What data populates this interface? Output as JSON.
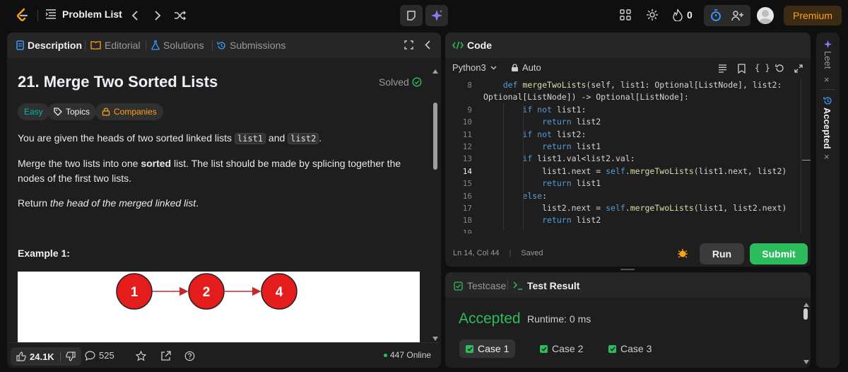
{
  "topbar": {
    "problem_list_label": "Problem List",
    "fire_count": "0",
    "premium_label": "Premium"
  },
  "description_panel": {
    "tabs": [
      {
        "label": "Description",
        "icon": "document-icon",
        "active": true
      },
      {
        "label": "Editorial",
        "icon": "book-icon",
        "active": false
      },
      {
        "label": "Solutions",
        "icon": "flask-icon",
        "active": false
      },
      {
        "label": "Submissions",
        "icon": "history-icon",
        "active": false
      }
    ],
    "title": "21. Merge Two Sorted Lists",
    "solved_label": "Solved",
    "tags": {
      "difficulty": "Easy",
      "topics": "Topics",
      "companies": "Companies"
    },
    "para1": {
      "before": "You are given the heads of two sorted linked lists ",
      "code1": "list1",
      "mid": " and ",
      "code2": "list2",
      "after": "."
    },
    "para2": {
      "before": "Merge the two lists into one ",
      "bold": "sorted",
      "after": " list. The list should be made by splicing together the nodes of the first two lists."
    },
    "para3": {
      "before": "Return ",
      "italic": "the head of the merged linked list",
      "after": "."
    },
    "example_label": "Example 1:",
    "figure_nodes": [
      "1",
      "2",
      "4"
    ],
    "footer": {
      "likes": "24.1K",
      "comments": "525",
      "online": "447 Online"
    }
  },
  "code_panel": {
    "title": "Code",
    "language": "Python3",
    "mode": "Auto",
    "lines": [
      {
        "n": "8",
        "tokens": [
          [
            "tx",
            "    "
          ],
          [
            "kw",
            "def "
          ],
          [
            "fn",
            "mergeTwoLists"
          ],
          [
            "tx",
            "(self, list1: Optional[ListNode], list2:"
          ]
        ]
      },
      {
        "n": "",
        "tokens": [
          [
            "tx",
            "Optional[ListNode]) -> Optional[ListNode]:"
          ]
        ]
      },
      {
        "n": "9",
        "tokens": [
          [
            "tx",
            "        "
          ],
          [
            "kw",
            "if not "
          ],
          [
            "tx",
            "list1:"
          ]
        ]
      },
      {
        "n": "10",
        "tokens": [
          [
            "tx",
            "            "
          ],
          [
            "kw",
            "return "
          ],
          [
            "tx",
            "list2"
          ]
        ]
      },
      {
        "n": "11",
        "tokens": [
          [
            "tx",
            "        "
          ],
          [
            "kw",
            "if not "
          ],
          [
            "tx",
            "list2:"
          ]
        ]
      },
      {
        "n": "12",
        "tokens": [
          [
            "tx",
            "            "
          ],
          [
            "kw",
            "return "
          ],
          [
            "tx",
            "list1"
          ]
        ]
      },
      {
        "n": "13",
        "tokens": [
          [
            "tx",
            "        "
          ],
          [
            "kw",
            "if "
          ],
          [
            "tx",
            "list1.val<list2.val:"
          ]
        ]
      },
      {
        "n": "14",
        "tokens": [
          [
            "tx",
            "            list1.next = "
          ],
          [
            "kw",
            "self"
          ],
          [
            "tx",
            "."
          ],
          [
            "fn",
            "mergeTwoLists"
          ],
          [
            "tx",
            "(list1.next, list2)"
          ]
        ]
      },
      {
        "n": "15",
        "tokens": [
          [
            "tx",
            "            "
          ],
          [
            "kw",
            "return "
          ],
          [
            "tx",
            "list1"
          ]
        ]
      },
      {
        "n": "16",
        "tokens": [
          [
            "tx",
            "        "
          ],
          [
            "kw",
            "else"
          ],
          [
            "tx",
            ":"
          ]
        ]
      },
      {
        "n": "17",
        "tokens": [
          [
            "tx",
            "            list2.next = "
          ],
          [
            "kw",
            "self"
          ],
          [
            "tx",
            "."
          ],
          [
            "fn",
            "mergeTwoLists"
          ],
          [
            "tx",
            "(list1, list2.next)"
          ]
        ]
      },
      {
        "n": "18",
        "tokens": [
          [
            "tx",
            "            "
          ],
          [
            "kw",
            "return "
          ],
          [
            "tx",
            "list2"
          ]
        ]
      },
      {
        "n": "19",
        "tokens": [
          [
            "tx",
            ""
          ]
        ]
      }
    ],
    "cursor": "Ln 14, Col 44",
    "saved": "Saved",
    "run_label": "Run",
    "submit_label": "Submit"
  },
  "result_panel": {
    "tabs": {
      "testcase": "Testcase",
      "result": "Test Result"
    },
    "status": "Accepted",
    "runtime": "Runtime: 0 ms",
    "cases": [
      "Case 1",
      "Case 2",
      "Case 3"
    ]
  },
  "side_strip": {
    "leet_label": "Leet",
    "accepted_label": "Accepted"
  },
  "colors": {
    "accent": "#ffa116",
    "success": "#2cbb5d",
    "keyword": "#569cd6",
    "function": "#dcdcaa"
  }
}
